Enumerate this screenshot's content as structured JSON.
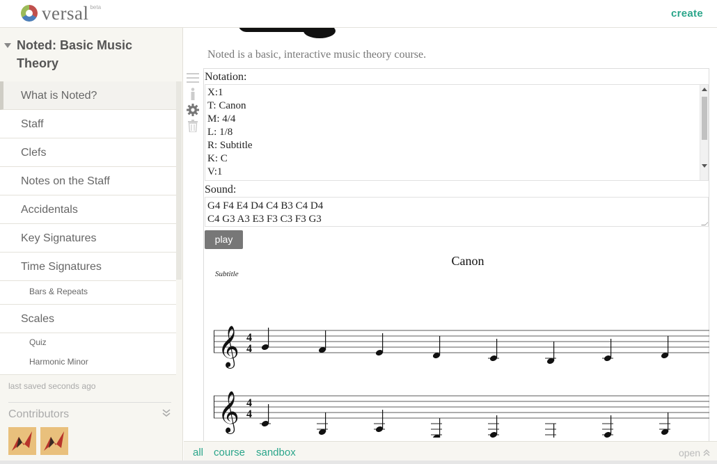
{
  "app": {
    "logo_text": "versal",
    "beta_label": "beta",
    "create_label": "create"
  },
  "sidebar": {
    "course_title": "Noted: Basic Music Theory",
    "lessons": [
      {
        "label": "What is Noted?"
      },
      {
        "label": "Staff"
      },
      {
        "label": "Clefs"
      },
      {
        "label": "Notes on the Staff"
      },
      {
        "label": "Accidentals"
      },
      {
        "label": "Key Signatures"
      },
      {
        "label": "Time Signatures"
      },
      {
        "label": "Bars & Repeats"
      },
      {
        "label": "Scales"
      },
      {
        "label": "Quiz"
      },
      {
        "label": "Harmonic Minor"
      }
    ],
    "saved_status": "last saved seconds ago",
    "contributors_label": "Contributors",
    "contributors_toggle": "⌄⌄"
  },
  "main": {
    "intro_text": "Noted is a basic, interactive music theory course.",
    "notation_label": "Notation:",
    "notation_lines": [
      "X:1",
      "T: Canon",
      "M: 4/4",
      "L: 1/8",
      "R: Subtitle",
      "K: C",
      "V:1"
    ],
    "sound_label": "Sound:",
    "sound_lines": [
      "G4 F4 E4 D4 C4 B3 C4 D4",
      "C4 G3 A3 E3 F3 C3 F3 G3"
    ],
    "play_label": "play",
    "score": {
      "title": "Canon",
      "subtitle": "Subtitle",
      "time_sig_top": "4",
      "time_sig_bottom": "4",
      "voice1": [
        "G4",
        "F4",
        "E4",
        "D4",
        "C4",
        "B3",
        "C4",
        "D4"
      ],
      "voice2": [
        "C4",
        "G3",
        "A3",
        "E3",
        "F3",
        "C3",
        "F3",
        "G3"
      ]
    }
  },
  "footer": {
    "link_all": "all",
    "link_course": "course",
    "link_sandbox": "sandbox",
    "open_label": "open"
  },
  "colors": {
    "accent": "#2aa58a",
    "sidebar_bg": "#f7f6f1",
    "button_bg": "#777777"
  }
}
